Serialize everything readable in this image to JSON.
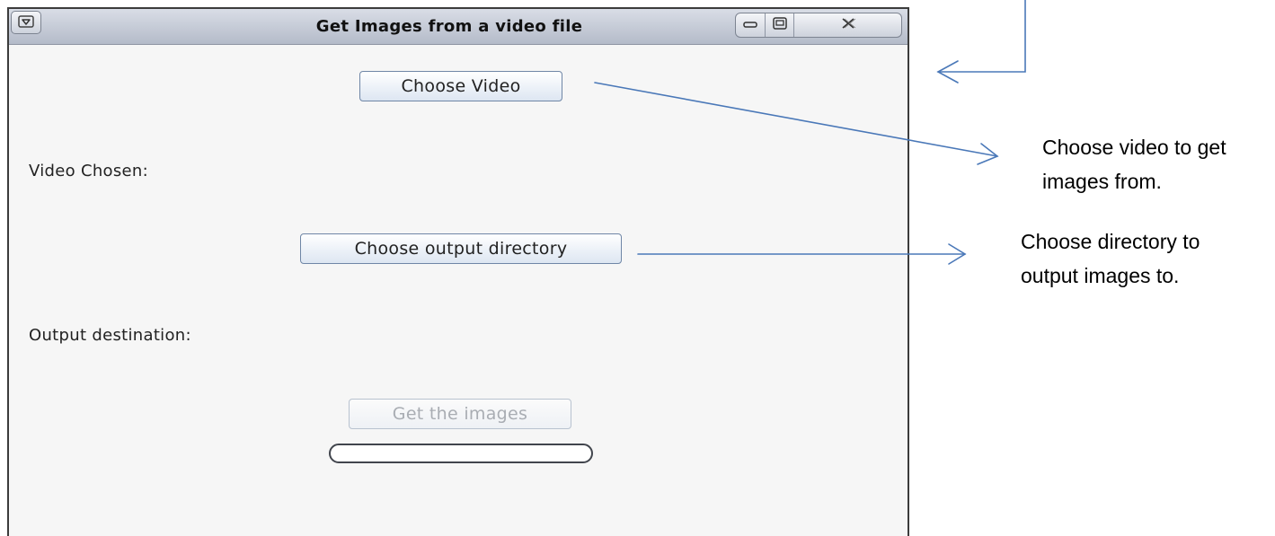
{
  "window": {
    "title": "Get Images from a video file"
  },
  "buttons": {
    "choose_video": "Choose Video",
    "choose_output": "Choose output directory",
    "get_images": "Get the images"
  },
  "labels": {
    "video_chosen": "Video Chosen:",
    "output_destination": "Output destination:"
  },
  "progress": {
    "value": 0
  },
  "annotations": {
    "choose_video_line1": "Choose video to get",
    "choose_video_line2": "images from.",
    "choose_output_line1": "Choose directory to",
    "choose_output_line2": "output images to."
  },
  "icons": {
    "menu": "menu-triangle-icon",
    "minimize": "minimize-icon",
    "maximize": "maximize-icon",
    "close": "close-icon"
  },
  "colors": {
    "annotation_line": "#4a78b8",
    "titlebar": "#c6ccd8",
    "window_bg": "#f6f6f6"
  }
}
